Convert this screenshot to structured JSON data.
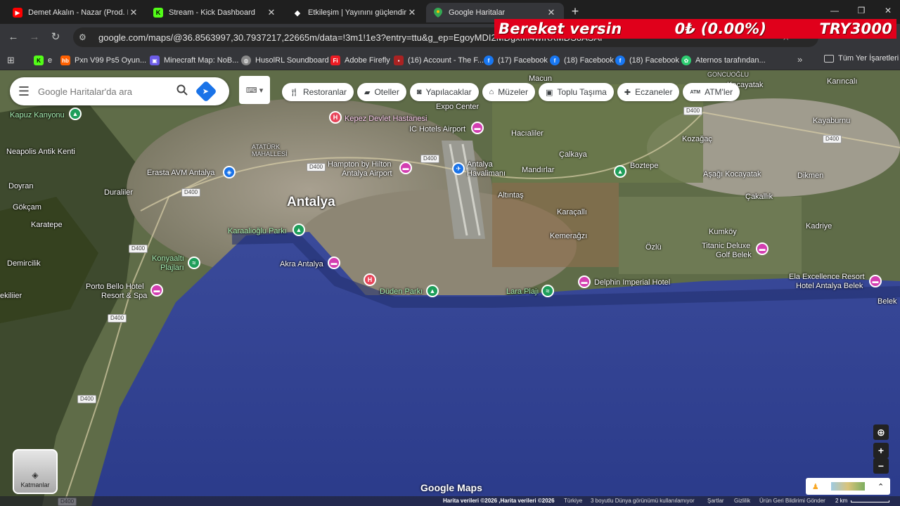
{
  "browser": {
    "tabs": [
      {
        "title": "Demet Akalın - Nazar (Prod. Me",
        "favicon": "youtube-icon",
        "fav_color": "#ff0000"
      },
      {
        "title": "Stream - Kick Dashboard",
        "favicon": "kick-icon",
        "fav_color": "#53fc18"
      },
      {
        "title": "Etkileşim | Yayınını güçlendirme",
        "favicon": "diamond-icon",
        "fav_color": "#ffffff"
      },
      {
        "title": "Google Haritalar",
        "favicon": "maps-pin-icon",
        "fav_color": "#34a853"
      }
    ],
    "url": "google.com/maps/@36.8563997,30.7937217,22665m/data=!3m1!1e3?entry=ttu&g_ep=EgoyMDI2MDgxMi4wIKXMDSoASAFQAw%3D%3D",
    "bookmarks": [
      {
        "label": "e",
        "icon": "kick-icon",
        "color": "#53fc18"
      },
      {
        "label": "Pxn V99 Ps5 Oyun...",
        "icon": "hb-icon",
        "color": "#ff6000"
      },
      {
        "label": "Minecraft Map: NoB...",
        "icon": "minecraft-icon",
        "color": "#6c5ce7"
      },
      {
        "label": "HusolRL Soundboard",
        "icon": "globe-icon",
        "color": "#888888"
      },
      {
        "label": "Adobe Firefly",
        "icon": "adobe-icon",
        "color": "#ed1c24"
      },
      {
        "label": "(16) Account - The F...",
        "icon": "account-icon",
        "color": "#aa2222"
      },
      {
        "label": "(17) Facebook",
        "icon": "facebook-icon",
        "color": "#1877f2"
      },
      {
        "label": "(18) Facebook",
        "icon": "facebook-icon",
        "color": "#1877f2"
      },
      {
        "label": "(18) Facebook",
        "icon": "facebook-icon",
        "color": "#1877f2"
      },
      {
        "label": "Aternos tarafından...",
        "icon": "aternos-icon",
        "color": "#2ecc71"
      }
    ],
    "all_bookmarks": "Tüm Yer İşaretleri"
  },
  "stream_overlay": {
    "text1": "Bereket versin",
    "text2": "0₺ (0.00%)",
    "text3": "TRY3000"
  },
  "search": {
    "placeholder": "Google Haritalar'da ara"
  },
  "chips": [
    {
      "label": "Restoranlar",
      "icon": "fork-knife-icon"
    },
    {
      "label": "Oteller",
      "icon": "bed-icon"
    },
    {
      "label": "Yapılacaklar",
      "icon": "camera-icon"
    },
    {
      "label": "Müzeler",
      "icon": "museum-icon"
    },
    {
      "label": "Toplu Taşıma",
      "icon": "bus-icon"
    },
    {
      "label": "Eczaneler",
      "icon": "pharmacy-icon"
    },
    {
      "label": "ATM'ler",
      "icon": "atm-icon"
    }
  ],
  "map_labels": {
    "antalya": "Antalya",
    "kepez": "Kepez Devlet Hastanesi",
    "ichotels": "IC Hotels Airport",
    "expo": "Expo Center",
    "hampton1": "Hampton by Hilton",
    "hampton2": "Antalya Airport",
    "havalimani1": "Antalya",
    "havalimani2": "Havalimanı",
    "erasta": "Erasta AVM Antalya",
    "ataturk1": "ATATÜRK",
    "ataturk2": "MAHALLESİ",
    "neapolis": "Neapolis Antik Kenti",
    "kapuz": "Kapuz Kanyonu",
    "doyran": "Doyran",
    "duraliler": "Duraliler",
    "gokcam": "Gökçam",
    "karatepe": "Karatepe",
    "karaalioglu": "Karaalioğlu Parkı",
    "konyaalti1": "Konyaaltı",
    "konyaalti2": "Plajları",
    "demircilik": "Demircilik",
    "portobello1": "Porto Bello Hotel",
    "portobello2": "Resort & Spa",
    "ekiliier": "ekiliier",
    "akra": "Akra Antalya",
    "duden": "Düden Parkı",
    "lara": "Lara Plajı",
    "delphin": "Delphin Imperial Hotel",
    "hacialiler": "Hacıaliler",
    "calkaya": "Çalkaya",
    "mandirlar": "Mandırlar",
    "altintas": "Altıntaş",
    "karacalli": "Karaçallı",
    "kemeragzi": "Kemerağzı",
    "ozlu": "Özlü",
    "boztepe": "Boztepe",
    "kozagac": "Kozağaç",
    "asagi": "Aşağı Kocayatak",
    "cakallik": "Çakallık",
    "kumkoy": "Kumköy",
    "titanic1": "Titanic Deluxe",
    "titanic2": "Golf Belek",
    "ela1": "Ela Excellence Resort",
    "ela2": "Hotel Antalya Belek",
    "belek": "Belek",
    "kadriye": "Kadriye",
    "dikmen": "Dikmen",
    "kayaburnu": "Kayaburnu",
    "karincali": "Karıncalı",
    "kocayatak": "Kocayatak",
    "goncuoglu": "GONCUOĞLU",
    "macun": "Macun",
    "road_d400": "D400"
  },
  "map_ui": {
    "layers_label": "Katmanlar",
    "logo": "Google Maps",
    "attribution": [
      "Harita verileri ©2026 ,Harita verileri ©2026",
      "Türkiye",
      "3 boyutlu Dünya görünümü kullanılamıyor",
      "Şartlar",
      "Gizlilik",
      "Ürün Geri Bildirimi Gönder",
      "2 km"
    ]
  }
}
